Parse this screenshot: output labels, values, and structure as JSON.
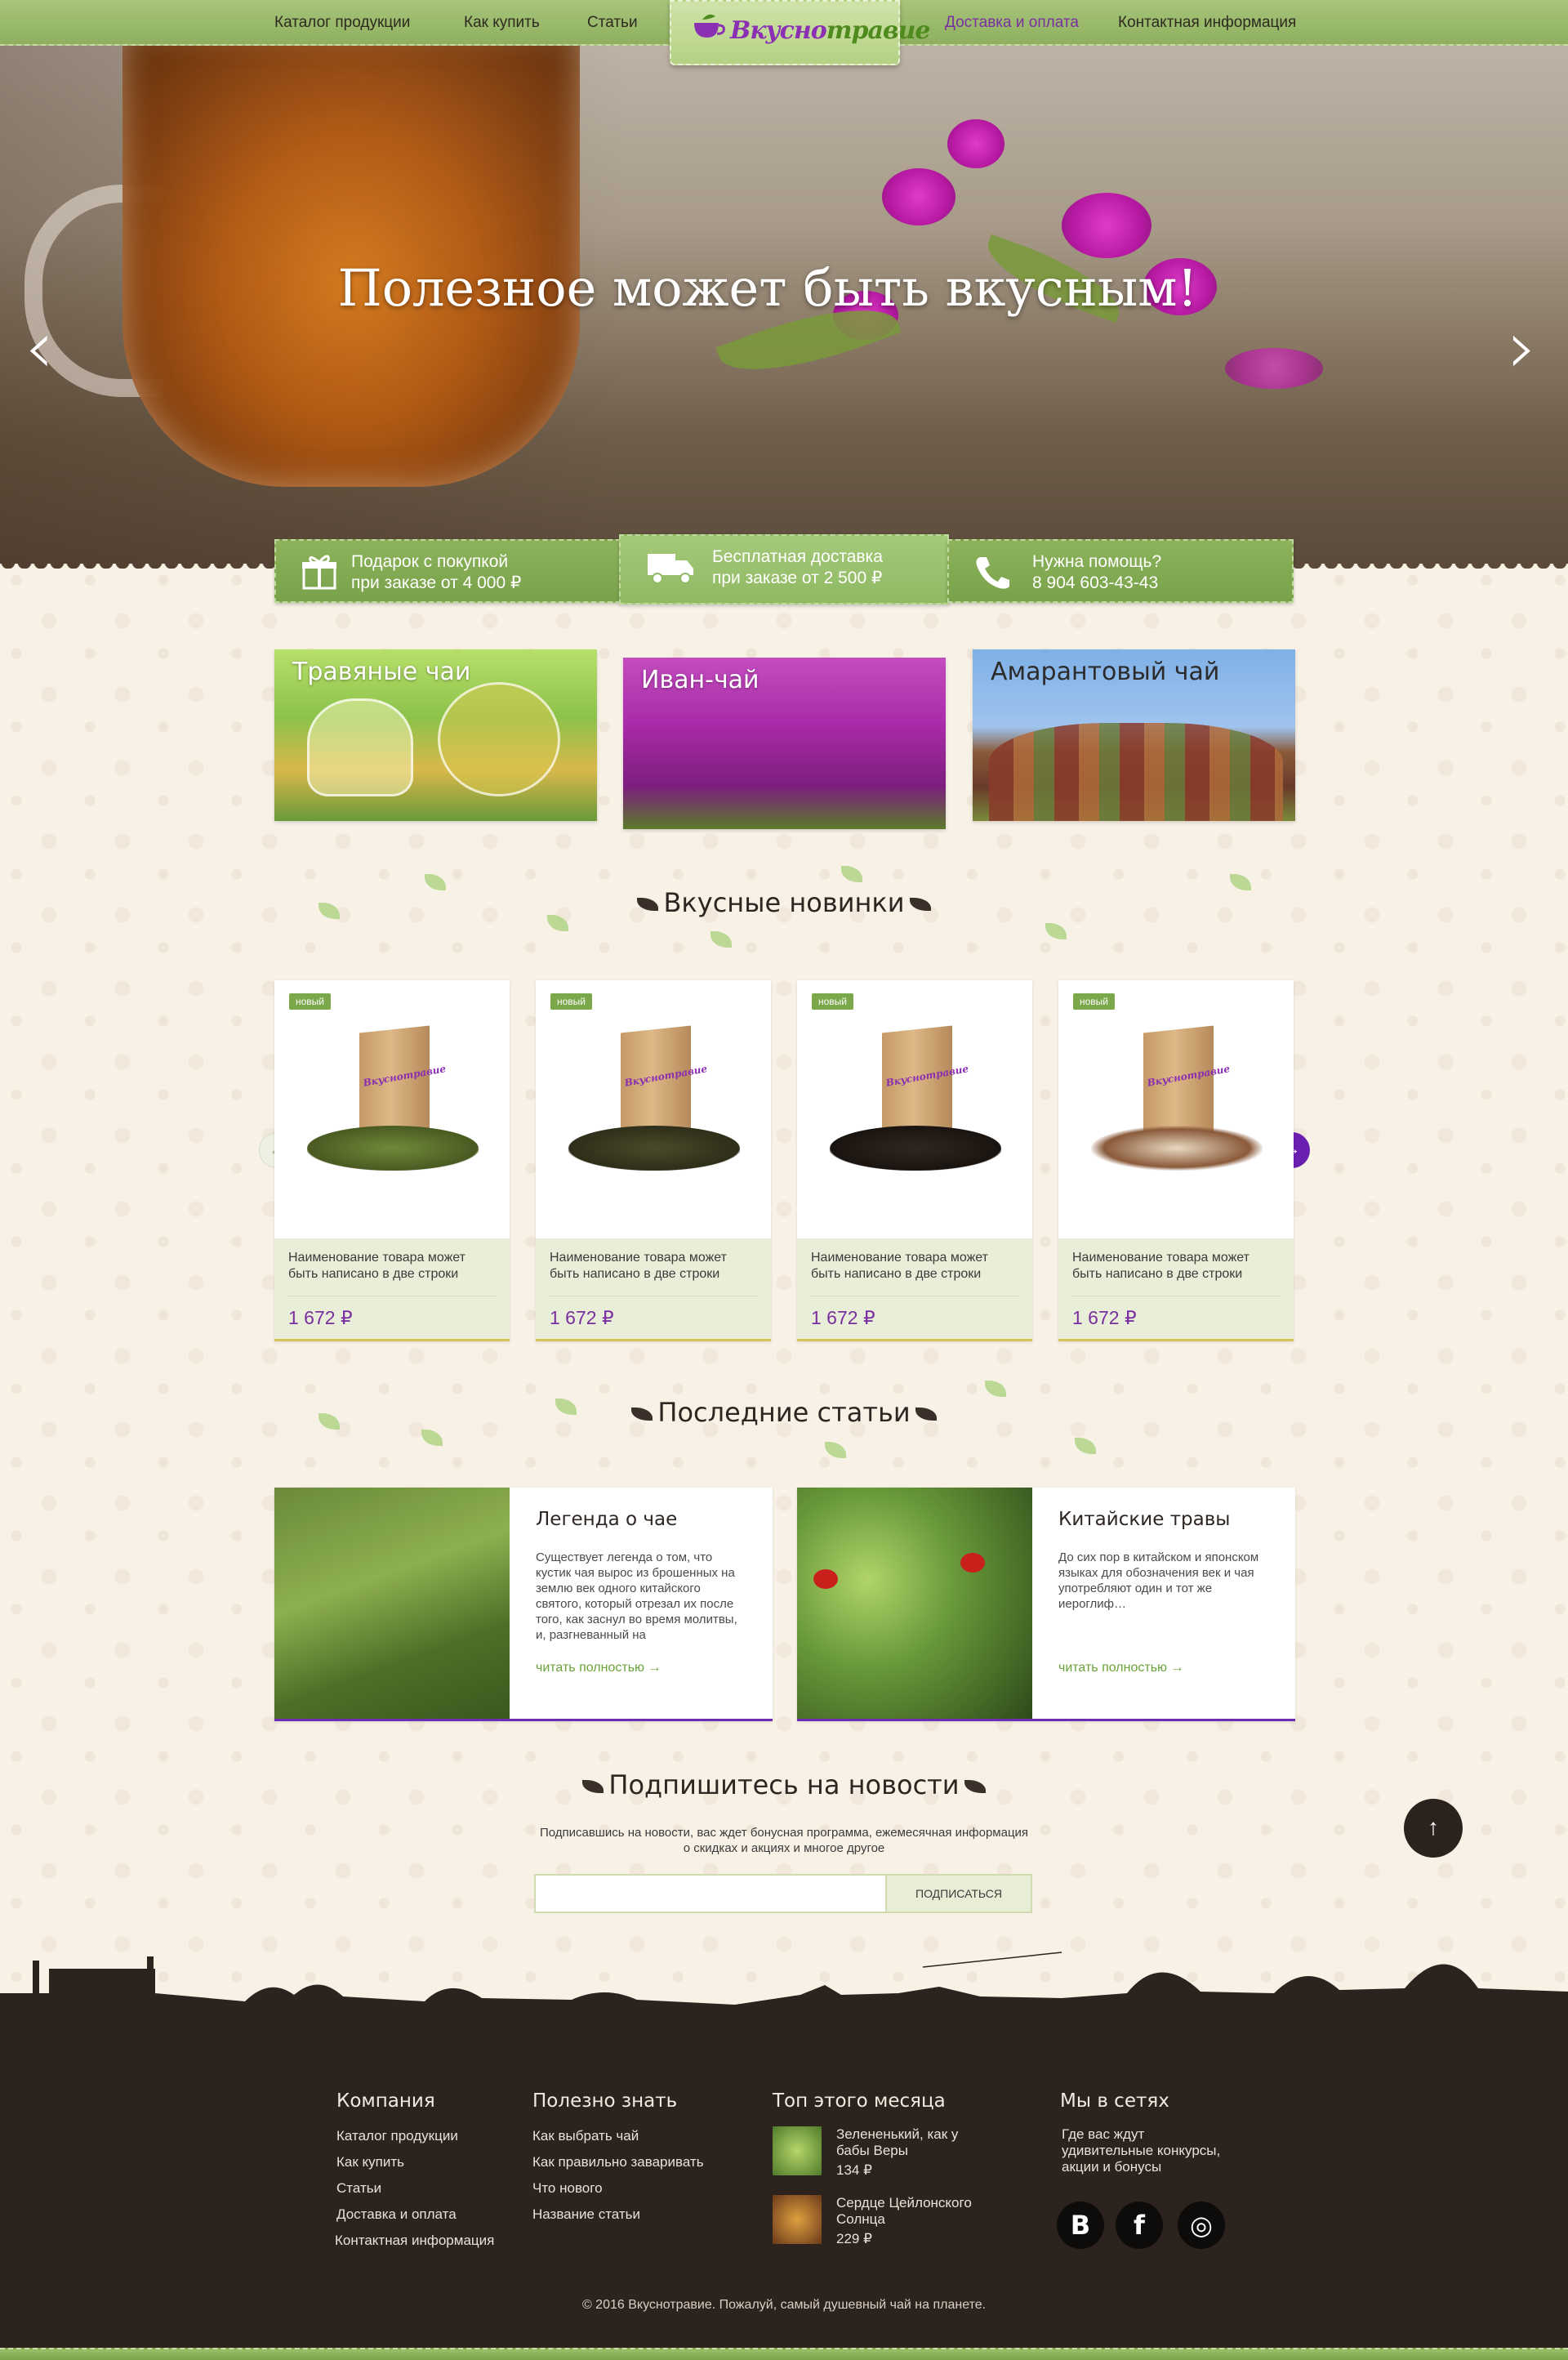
{
  "nav": {
    "items_left": [
      "Каталог продукции",
      "Как купить",
      "Статьи"
    ],
    "items_right": [
      "Доставка и оплата",
      "Контактная информация"
    ],
    "active": "Доставка и оплата",
    "logo_part1": "Вкусно",
    "logo_part2": "травие"
  },
  "hero": {
    "title": "Полезное может быть вкусным!",
    "prev_icon": "‹",
    "next_icon": "›"
  },
  "benefits": [
    {
      "icon": "gift-icon",
      "line1": "Подарок с покупкой",
      "line2": "при заказе от 4 000 ₽"
    },
    {
      "icon": "truck-icon",
      "line1": "Бесплатная доставка",
      "line2": "при заказе от 2 500 ₽"
    },
    {
      "icon": "phone-icon",
      "line1": "Нужна помощь?",
      "line2": "8 904 603-43-43"
    }
  ],
  "categories": [
    "Травяные чаи",
    "Иван-чай",
    "Амарантовый чай"
  ],
  "new_section": {
    "title": "Вкусные новинки",
    "prev_icon": "←",
    "next_icon": "→",
    "products": [
      {
        "badge": "новый",
        "name": "Наименование товара может быть написано в две строки",
        "price": "1 672 ₽",
        "logo": "Вкуснотравие"
      },
      {
        "badge": "новый",
        "name": "Наименование товара может быть написано в две строки",
        "price": "1 672 ₽",
        "logo": "Вкуснотравие"
      },
      {
        "badge": "новый",
        "name": "Наименование товара может быть написано в две строки",
        "price": "1 672 ₽",
        "logo": "Вкуснотравие"
      },
      {
        "badge": "новый",
        "name": "Наименование товара может быть написано в две строки",
        "price": "1 672 ₽",
        "logo": "Вкуснотравие"
      }
    ]
  },
  "articles_section": {
    "title": "Последние статьи",
    "articles": [
      {
        "title": "Легенда о чае",
        "text": "Существует легенда о том, что кустик чая вырос из брошенных на землю век одного китайского святого, который отрезал их после того, как заснул во время молитвы, и, разгневанный на",
        "more": "читать полностью →"
      },
      {
        "title": "Китайские травы",
        "text": "До сих пор в китайском и японском языках для обозначения век и чая употребляют один и тот же иероглиф…",
        "more": "читать полностью →"
      }
    ]
  },
  "subscribe": {
    "title": "Подпишитесь на новости",
    "description": "Подписавшись на новости, вас ждет бонусная программа, ежемесячная информация о скидках и акциях и многое другое",
    "input_value": "",
    "button": "ПОДПИСАТЬСЯ",
    "to_top_icon": "↑"
  },
  "footer": {
    "company": {
      "title": "Компания",
      "links": [
        "Каталог продукции",
        "Как купить",
        "Статьи",
        "Доставка и оплата",
        "Контактная информация"
      ]
    },
    "useful": {
      "title": "Полезно знать",
      "links": [
        "Как выбрать чай",
        "Как правильно заваривать",
        "Что нового",
        "Название статьи"
      ]
    },
    "top": {
      "title": "Топ этого месяца",
      "items": [
        {
          "line1": "Зелененький, как у",
          "line2": "бабы Веры",
          "price": "134 ₽"
        },
        {
          "line1": "Сердце Цейлонского",
          "line2": "Солнца",
          "price": "229 ₽"
        }
      ]
    },
    "social": {
      "title": "Мы в сетях",
      "line1": "Где вас ждут",
      "line2": "удивительные конкурсы,",
      "line3": "акции и бонусы",
      "icons": [
        "В",
        "f",
        "◎"
      ]
    },
    "copyright": "© 2016 Вкуснотравие. Пожалуй, самый душевный чай на планете."
  },
  "colors": {
    "accent_green": "#8cb35c",
    "accent_purple": "#7a2fa0",
    "footer_bg": "#2c231e",
    "page_bg": "#f8f1e6"
  }
}
